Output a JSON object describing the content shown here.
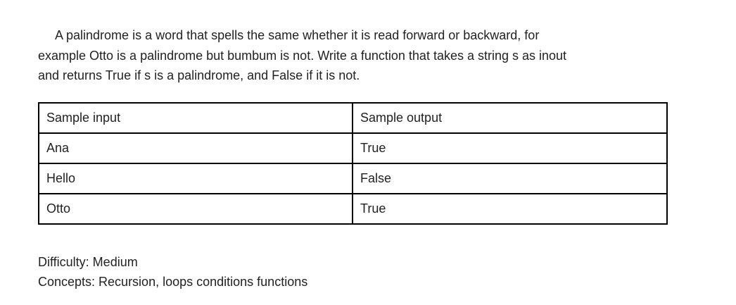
{
  "intro": {
    "line1": "A palindrome is a word that spells the same whether it is read forward or backward, for",
    "line2": "example Otto is a palindrome but bumbum is not. Write a function that takes a string s as inout",
    "line3": "and returns True if s is a palindrome, and False if it is not."
  },
  "table": {
    "headers": [
      "Sample input",
      "Sample output"
    ],
    "rows": [
      [
        "Ana",
        "True"
      ],
      [
        "Hello",
        "False"
      ],
      [
        "Otto",
        "True"
      ]
    ]
  },
  "meta": {
    "difficulty": "Difficulty: Medium",
    "concepts": "Concepts: Recursion, loops conditions functions"
  }
}
